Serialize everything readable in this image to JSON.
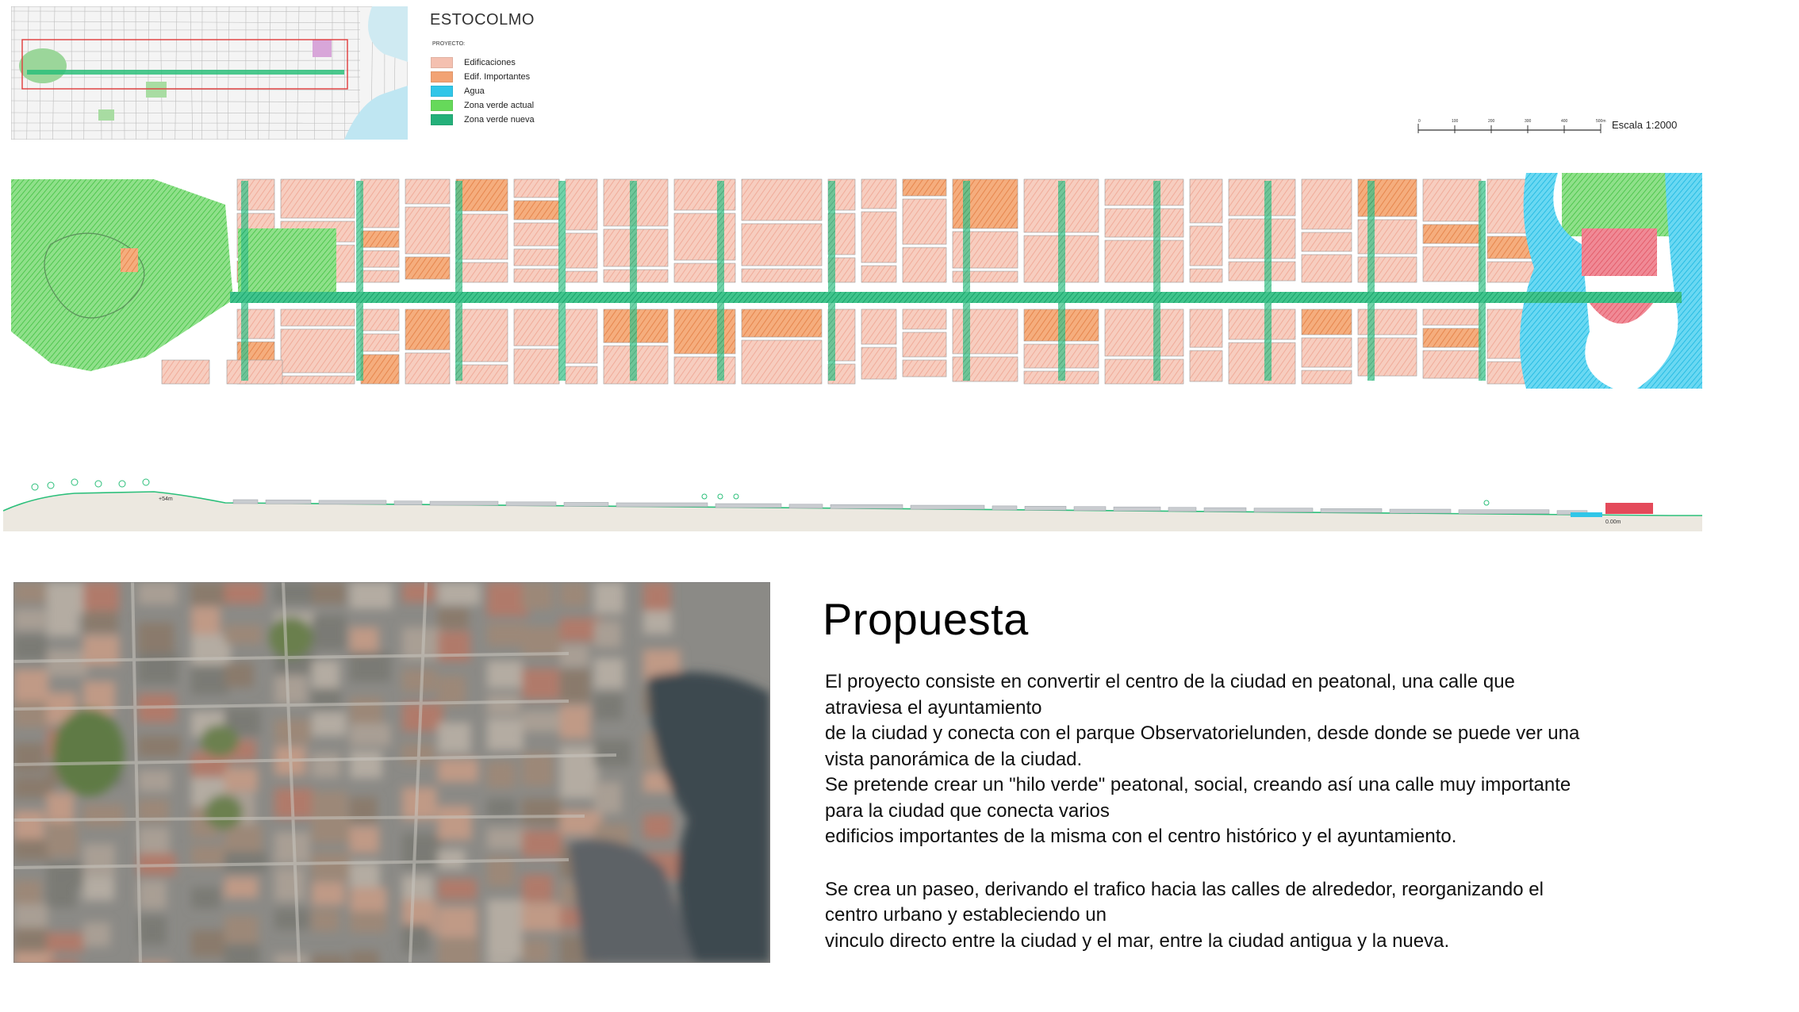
{
  "header": {
    "title": "ESTOCOLMO",
    "legend_heading": "PROYECTO:",
    "legend": [
      {
        "label": "Edificaciones",
        "color": "#f4c0b0"
      },
      {
        "label": "Edif. Importantes",
        "color": "#f2a374"
      },
      {
        "label": "Agua",
        "color": "#30c6e8"
      },
      {
        "label": "Zona verde actual",
        "color": "#66d95a"
      },
      {
        "label": "Zona verde nueva",
        "color": "#24b07a"
      }
    ],
    "scale": {
      "ticks": [
        "0",
        "100",
        "200",
        "300",
        "400",
        "500m"
      ],
      "label": "Escala  1:2000"
    }
  },
  "section": {
    "elevation_left": "+54m",
    "elevation_right": "0.00m"
  },
  "text": {
    "heading": "Propuesta",
    "paragraph1_lines": [
      "El proyecto consiste en convertir el centro de la ciudad en peatonal, una calle que",
      "atraviesa el ayuntamiento",
      "de la ciudad y conecta con el parque Observatorielunden, desde donde se puede ver una",
      "vista panorámica de la ciudad.",
      "Se pretende crear un \"hilo verde\" peatonal, social, creando así una calle muy importante",
      "para la ciudad que conecta varios",
      "edificios importantes de la misma con el centro histórico y el ayuntamiento."
    ],
    "paragraph2_lines": [
      "Se crea un paseo, derivando el trafico hacia las calles de alrededor, reorganizando el",
      "centro urbano y estableciendo un",
      "vinculo directo entre la ciudad y el mar, entre la ciudad antigua y la nueva."
    ]
  },
  "colors": {
    "building": "#f4c0b0",
    "important": "#f2a374",
    "water": "#30c6e8",
    "green_existing": "#66d95a",
    "green_new": "#24b07a"
  }
}
